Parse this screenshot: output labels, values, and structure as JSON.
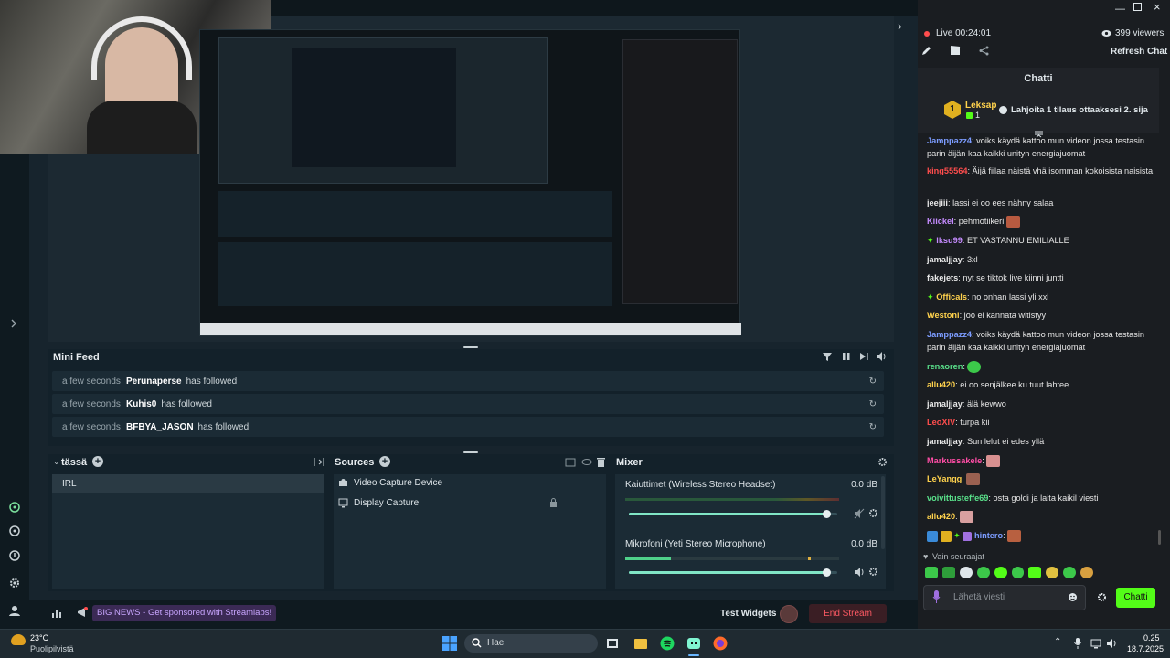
{
  "preview": {
    "mini_feed_title": "Mini Feed",
    "events": [
      {
        "time": "a few seconds",
        "name": "Perunaperse",
        "action": "has followed"
      },
      {
        "time": "a few seconds",
        "name": "Kuhis0",
        "action": "has followed"
      },
      {
        "time": "a few seconds",
        "name": "BFBYA_JASON",
        "action": "has followed"
      }
    ]
  },
  "scenes": {
    "title": "tässä",
    "items": [
      "IRL"
    ]
  },
  "sources": {
    "title": "Sources",
    "items": [
      "Video Capture Device",
      "Display Capture"
    ]
  },
  "mixer": {
    "title": "Mixer",
    "channels": [
      {
        "name": "Kaiuttimet (Wireless Stereo Headset)",
        "level": "0.0 dB",
        "fill": 0.95
      },
      {
        "name": "Mikrofoni (Yeti Stereo Microphone)",
        "level": "0.0 dB",
        "fill": 0.95
      }
    ]
  },
  "bottom": {
    "news": "BIG NEWS - Get sponsored with Streamlabs!",
    "test_widgets": "Test Widgets",
    "end_stream": "End Stream"
  },
  "chat": {
    "live_label": "Live 00:24:01",
    "viewers": "399 viewers",
    "refresh": "Refresh Chat",
    "title": "Chatti",
    "pinned": {
      "rank": "1",
      "user": "Leksap",
      "count": "1",
      "text": "Lahjoita 1 tilaus ottaaksesi 2. sija"
    },
    "messages": [
      {
        "user": "Jamppazz4",
        "color": "#7c9cff",
        "text": "voiks käydä kattoo mun videon jossa testasin parin äijän kaa kaikki unityn energiajuomat"
      },
      {
        "user": "king55564",
        "color": "#ff4d4d",
        "text": "Äijä fiilaa näistä vhä isomman kokoisista naisista"
      },
      {
        "user": "jeejiii",
        "color": "#e8e8e8",
        "text": "lassi ei oo ees nähny salaa"
      },
      {
        "user": "Kiickel",
        "color": "#c58bff",
        "text": "pehmotiikeri"
      },
      {
        "user": "lksu99",
        "color": "#c58bff",
        "text": "ET VASTANNU EMILIALLE"
      },
      {
        "user": "jamaljjay",
        "color": "#e8e8e8",
        "text": "3xl"
      },
      {
        "user": "fakejets",
        "color": "#e8e8e8",
        "text": "nyt se tiktok live kiinni juntti"
      },
      {
        "user": "Officals",
        "color": "#ffd24d",
        "text": "no onhan lassi yli xxl"
      },
      {
        "user": "Westoni",
        "color": "#ffd24d",
        "text": "joo ei kannata witistyy"
      },
      {
        "user": "Jamppazz4",
        "color": "#7c9cff",
        "text": "voiks käydä kattoo mun videon jossa testasin parin äijän kaa kaikki unityn energiajuomat"
      },
      {
        "user": "renaoren",
        "color": "#59e08a",
        "text": ""
      },
      {
        "user": "allu420",
        "color": "#ffd24d",
        "text": "ei oo senjälkee ku tuut lahtee"
      },
      {
        "user": "jamaljjay",
        "color": "#e8e8e8",
        "text": "älä kewwo"
      },
      {
        "user": "LeoXIV",
        "color": "#ff4d4d",
        "text": "turpa kii"
      },
      {
        "user": "jamaljjay",
        "color": "#e8e8e8",
        "text": "Sun lelut ei edes yllä"
      },
      {
        "user": "Markussakele",
        "color": "#ff4da6",
        "text": ""
      },
      {
        "user": "LeYangg",
        "color": "#ffd24d",
        "text": ""
      },
      {
        "user": "voivittusteffe69",
        "color": "#59e08a",
        "text": "osta goldi ja laita kaikil viesti"
      },
      {
        "user": "allu420",
        "color": "#ffd24d",
        "text": ""
      },
      {
        "user": "hintero",
        "color": "#7c9cff",
        "text": ""
      }
    ],
    "followers_only": "Vain seuraajat",
    "input_placeholder": "Lähetä viesti",
    "send": "Chatti"
  },
  "taskbar": {
    "weather_temp": "23°C",
    "weather_desc": "Puolipilvistä",
    "search": "Hae",
    "time": "0.25",
    "date": "18.7.2025"
  },
  "colors": {
    "accent": "#53fc18",
    "live": "#ff4d4d",
    "end_stream": "#d9474f",
    "news_bg": "#3b2a55"
  }
}
